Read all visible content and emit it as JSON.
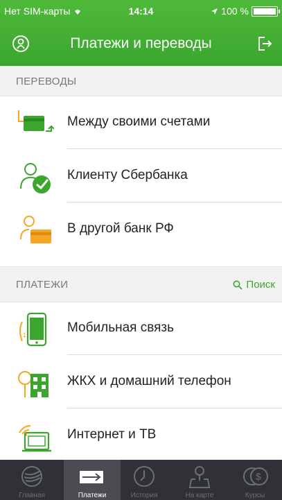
{
  "status_bar": {
    "carrier": "Нет SIM-карты ",
    "time": "14:14",
    "battery": "100 %"
  },
  "header": {
    "title": "Платежи и переводы"
  },
  "transfers": {
    "title": "ПЕРЕВОДЫ",
    "items": [
      {
        "label": "Между своими счетами",
        "icon": "own-accounts-transfer-icon"
      },
      {
        "label": "Клиенту Сбербанка",
        "icon": "sberbank-client-icon"
      },
      {
        "label": "В другой банк РФ",
        "icon": "other-bank-icon"
      }
    ]
  },
  "payments": {
    "title": "ПЛАТЕЖИ",
    "search_label": "Поиск",
    "items": [
      {
        "label": "Мобильная связь",
        "icon": "mobile-phone-icon"
      },
      {
        "label": "ЖКХ и домашний телефон",
        "icon": "housing-utilities-icon"
      },
      {
        "label": "Интернет и ТВ",
        "icon": "internet-tv-icon"
      }
    ]
  },
  "tabbar": {
    "tabs": [
      {
        "label": "Главная",
        "icon": "sberbank-logo-icon"
      },
      {
        "label": "Платежи",
        "icon": "payments-arrow-icon",
        "active": true
      },
      {
        "label": "История",
        "icon": "clock-icon"
      },
      {
        "label": "На карте",
        "icon": "map-pin-icon"
      },
      {
        "label": "Курсы",
        "icon": "currency-icon"
      }
    ]
  },
  "colors": {
    "accent": "#3aa62e",
    "icon_orange": "#f5a623",
    "tabbar_bg": "#2f3136"
  }
}
